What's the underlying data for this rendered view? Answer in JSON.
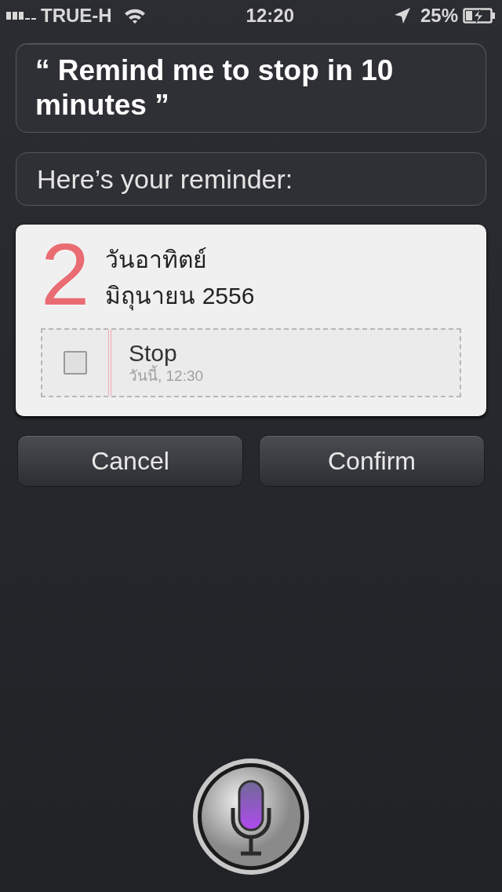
{
  "status_bar": {
    "carrier": "TRUE-H",
    "time": "12:20",
    "battery": "25%",
    "charging": true
  },
  "user_bubble": {
    "text": "“ Remind me to stop in 10 minutes ”"
  },
  "reply_bubble": {
    "text": "Here’s your reminder:"
  },
  "reminder_card": {
    "day_number": "2",
    "weekday": "วันอาทิตย์",
    "month_year": "มิถุนายน 2556",
    "tasks": [
      {
        "title": "Stop",
        "due": "วันนี้, 12:30",
        "checked": false
      }
    ]
  },
  "buttons": [
    {
      "label": "Cancel"
    },
    {
      "label": "Confirm"
    }
  ]
}
